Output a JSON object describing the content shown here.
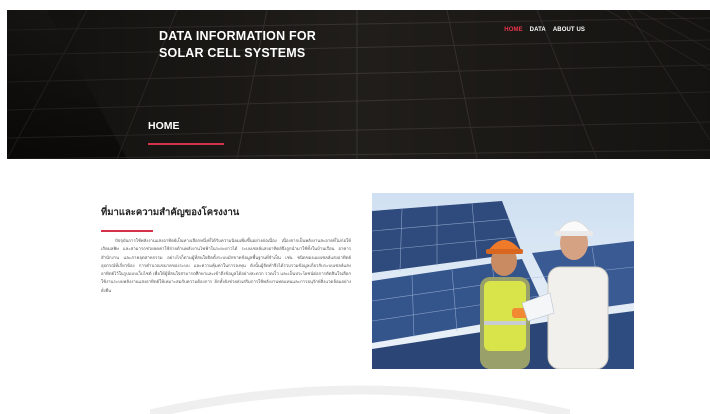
{
  "hero": {
    "title_line1": "DATA INFORMATION FOR",
    "title_line2": "SOLAR CELL SYSTEMS",
    "page_heading": "HOME"
  },
  "nav": {
    "items": [
      {
        "label": "HOME",
        "active": true
      },
      {
        "label": "DATA",
        "active": false
      },
      {
        "label": "ABOUT US",
        "active": false
      }
    ]
  },
  "content": {
    "section_title": "ที่มาและความสำคัญของโครงงาน",
    "paragraph": "ปัจจุบันการใช้พลังงานแสงอาทิตย์เป็นทางเลือกหนึ่งที่ได้รับความนิยมเพิ่มขึ้นอย่างต่อเนื่อง เนื่องจากเป็นพลังงานสะอาดที่ไม่ก่อให้เกิดมลพิษ และสามารถช่วยลดค่าใช้จ่ายด้านพลังงานไฟฟ้าในระยะยาวได้ ระบบเซลล์แสงอาทิตย์จึงถูกนำมาใช้ทั้งในบ้านเรือน อาคารสำนักงาน และภาคอุตสาหกรรม อย่างไรก็ตามผู้ที่สนใจติดตั้งระบบมักขาดข้อมูลพื้นฐานที่จำเป็น เช่น ชนิดของแผงเซลล์แสงอาทิตย์ อุปกรณ์ที่เกี่ยวข้อง การคำนวณขนาดของระบบ และความคุ้มค่าในการลงทุน ดังนั้นผู้จัดทำจึงได้รวบรวมข้อมูลเกี่ยวกับระบบเซลล์แสงอาทิตย์ไว้ในรูปแบบเว็บไซต์ เพื่อให้ผู้ที่สนใจสามารถศึกษาและเข้าถึงข้อมูลได้อย่างสะดวก รวดเร็ว และเป็นประโยชน์ต่อการตัดสินใจเลือกใช้งานระบบพลังงานแสงอาทิตย์ให้เหมาะสมกับความต้องการ อีกทั้งยังช่วยส่งเสริมการใช้พลังงานทดแทนและการอนุรักษ์สิ่งแวดล้อมอย่างยั่งยืน"
  },
  "photo": {
    "description_icon": "solar-workers-photo"
  },
  "colors": {
    "accent": "#d6324a",
    "hero_bg": "#1c1a18"
  }
}
